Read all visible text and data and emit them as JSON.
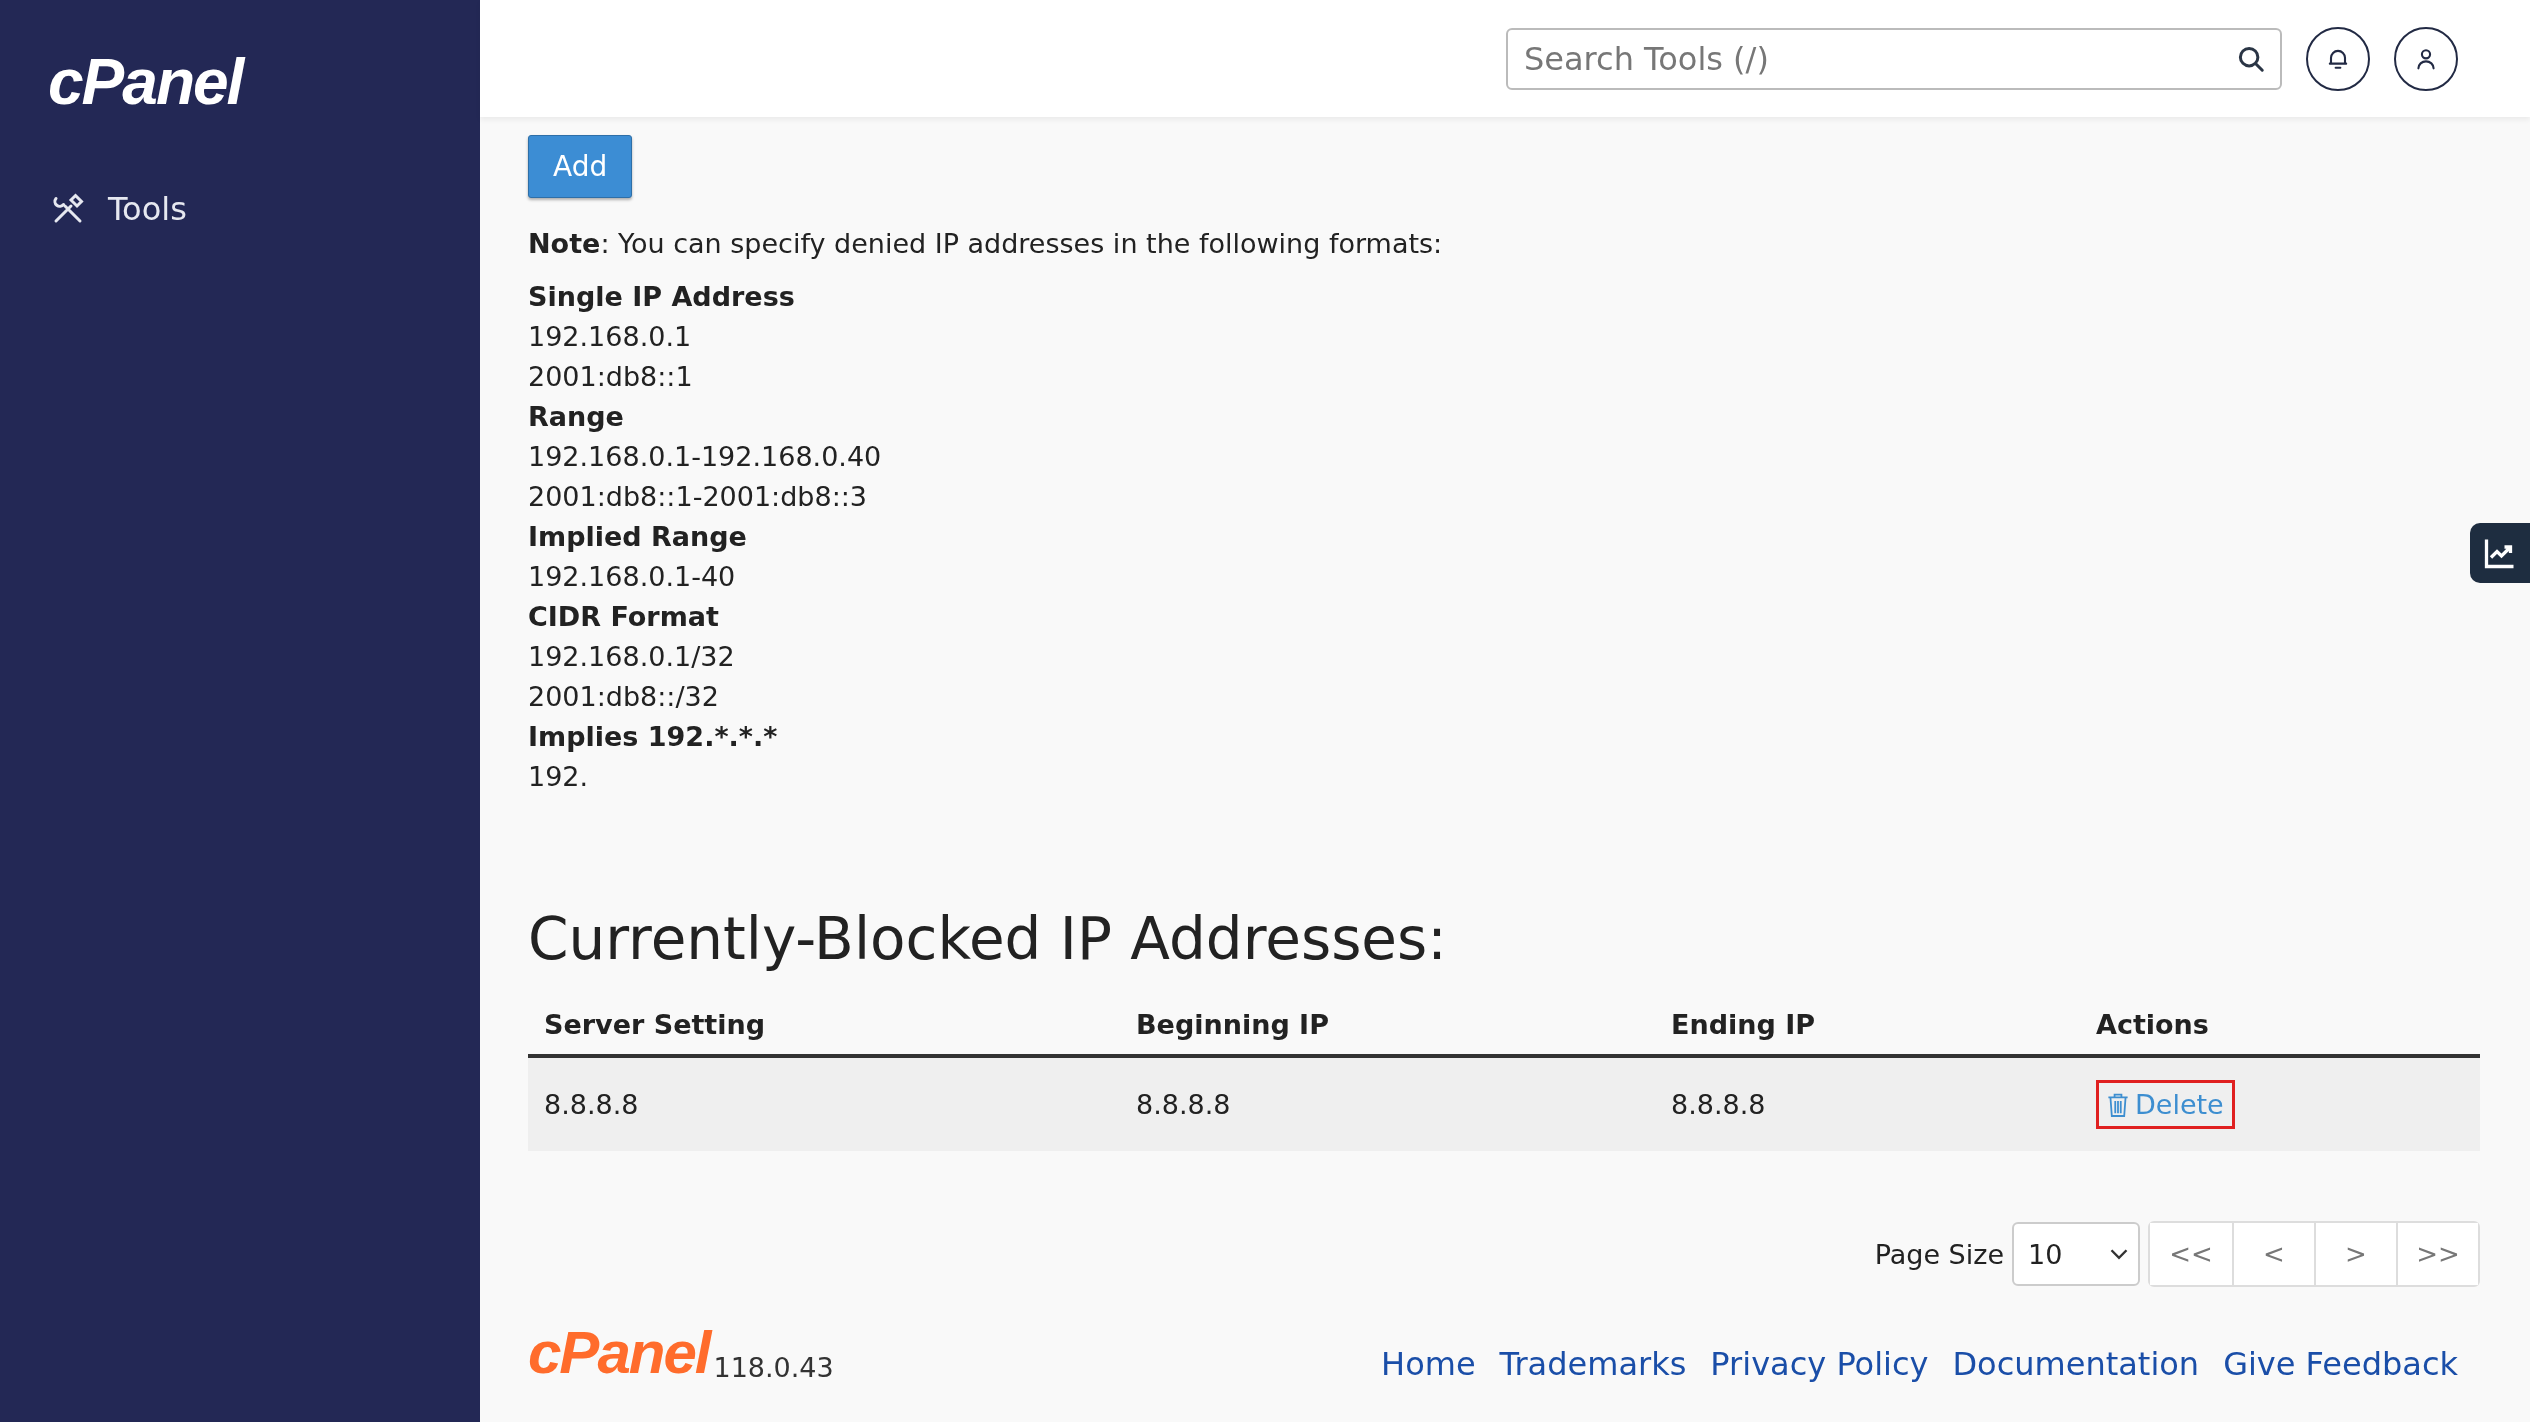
{
  "sidebar": {
    "logo": "cPanel",
    "items": [
      {
        "label": "Tools",
        "selected": false
      }
    ]
  },
  "header": {
    "search": {
      "placeholder": "Search Tools (/)"
    }
  },
  "add_button": "Add",
  "note": "**Note**: You can specify denied IP addresses in the following formats:",
  "formats": [
    {
      "title": "Single IP Address",
      "examples": [
        "192.168.0.1",
        "2001:db8::1"
      ]
    },
    {
      "title": "Range",
      "examples": [
        "192.168.0.1-192.168.0.40",
        "2001:db8::1-2001:db8::3"
      ]
    },
    {
      "title": "Implied Range",
      "examples": [
        "192.168.0.1-40"
      ]
    },
    {
      "title": "CIDR Format",
      "examples": [
        "192.168.0.1/32",
        "2001:db8::/32"
      ]
    },
    {
      "title": "Implies 192.*.*.*",
      "examples": [
        "192."
      ]
    }
  ],
  "section_title": "Currently-Blocked IP Addresses:",
  "table": {
    "columns": [
      "Server Setting",
      "Beginning IP",
      "Ending IP",
      "Actions"
    ],
    "rows": [
      {
        "cells": [
          "8.8.8.8",
          "8.8.8.8",
          "8.8.8.8"
        ],
        "action": "Delete",
        "highlighted": true
      }
    ]
  },
  "pagination": {
    "label": "Page Size",
    "page_size": "10",
    "buttons": [
      "<<",
      "<",
      ">",
      ">>"
    ]
  },
  "footer": {
    "logo": "cPanel",
    "version": "118.0.43",
    "links": [
      "Home",
      "Trademarks",
      "Privacy Policy",
      "Documentation",
      "Give Feedback"
    ]
  }
}
